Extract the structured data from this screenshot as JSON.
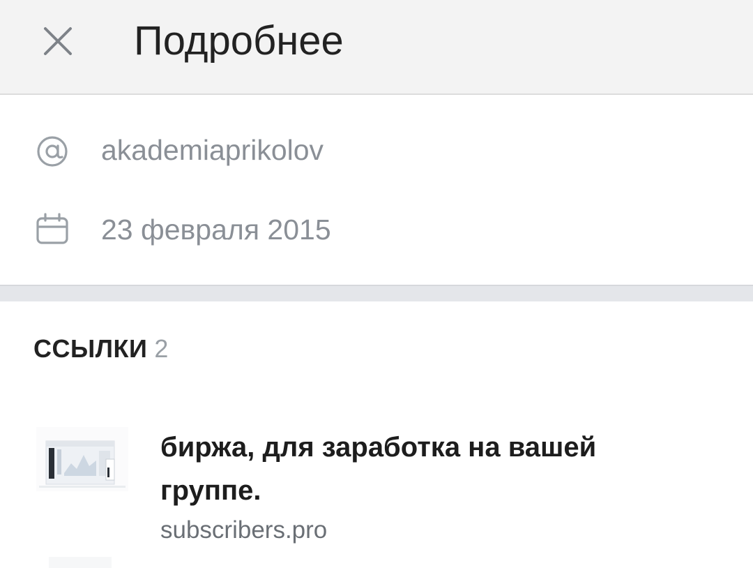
{
  "header": {
    "title": "Подробнее",
    "close_icon": "close-icon"
  },
  "info": {
    "username": "akademiaprikolov",
    "username_icon": "at-sign-icon",
    "date": "23 февраля 2015",
    "date_icon": "calendar-icon"
  },
  "links": {
    "label": "ССЫЛКИ",
    "count": "2",
    "items": [
      {
        "title": "биржа, для заработка на вашей группе.",
        "domain": "subscribers.pro",
        "thumbnail": "website-screenshot-thumbnail"
      }
    ]
  },
  "colors": {
    "header_bg": "#f3f3f3",
    "muted_text": "#8a8f96",
    "separator": "#e4e6ea",
    "title_text": "#222222"
  }
}
